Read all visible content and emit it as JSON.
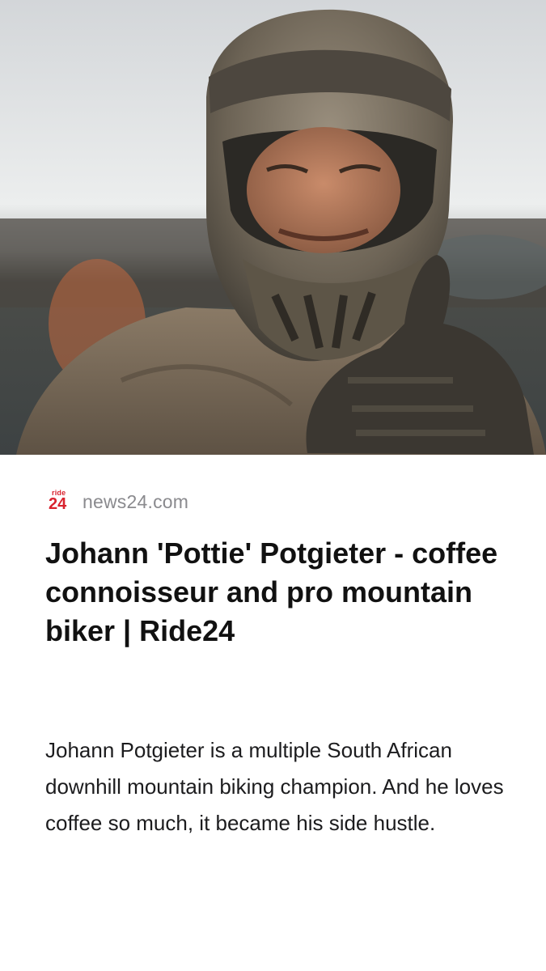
{
  "article_card": {
    "image": {
      "icon": "article-hero-photo"
    },
    "source": {
      "logo_small": "ride",
      "logo_big": "24",
      "name": "news24.com",
      "logo_color": "#d9232e"
    },
    "headline": "Johann 'Pottie' Potgieter - coffee connoisseur and pro mountain biker | Ride24",
    "summary": "Johann Potgieter is a multiple South African downhill mountain biking champion. And he loves coffee so much, it became his side hustle."
  }
}
